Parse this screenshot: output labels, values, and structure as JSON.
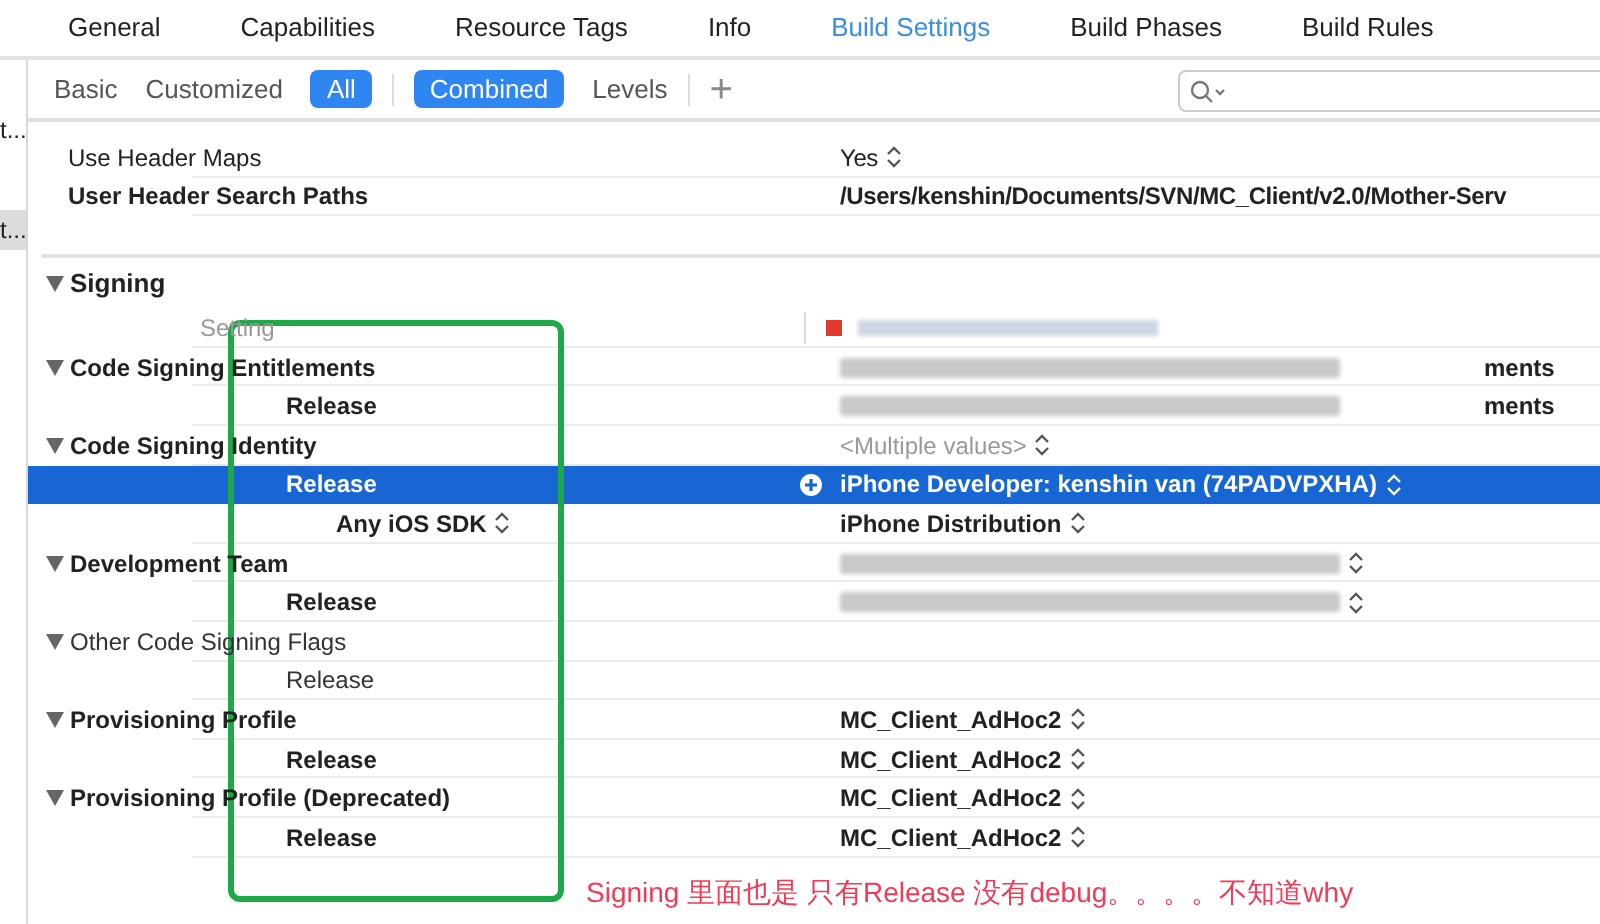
{
  "tabs": [
    {
      "label": "General",
      "selected": false
    },
    {
      "label": "Capabilities",
      "selected": false
    },
    {
      "label": "Resource Tags",
      "selected": false
    },
    {
      "label": "Info",
      "selected": false
    },
    {
      "label": "Build Settings",
      "selected": true
    },
    {
      "label": "Build Phases",
      "selected": false
    },
    {
      "label": "Build Rules",
      "selected": false
    }
  ],
  "sidebar": {
    "items": [
      {
        "label": "t...",
        "selected": false
      },
      {
        "label": "t...",
        "selected": true
      }
    ]
  },
  "filters": {
    "scope": [
      {
        "label": "Basic",
        "selected": false
      },
      {
        "label": "Customized",
        "selected": false
      },
      {
        "label": "All",
        "selected": true
      }
    ],
    "view": [
      {
        "label": "Combined",
        "selected": true
      },
      {
        "label": "Levels",
        "selected": false
      }
    ],
    "add": "+"
  },
  "rows_above": [
    {
      "label": "Use Header Maps",
      "bold": false,
      "value": "Yes",
      "value_bold": false,
      "stepper": true
    },
    {
      "label": "User Header Search Paths",
      "bold": true,
      "value": "/Users/kenshin/Documents/SVN/MC_Client/v2.0/Mother-Serv",
      "value_bold": true,
      "stepper": false
    }
  ],
  "section": {
    "title": "Signing",
    "expanded": true,
    "column_header": "Setting",
    "rows": [
      {
        "kind": "group",
        "label": "Code Signing Entitlements",
        "bold": true,
        "selected": false,
        "value": {
          "kind": "redacted",
          "tail": "ments"
        },
        "stepper": false
      },
      {
        "kind": "child",
        "label": "Release",
        "bold": true,
        "selected": false,
        "value": {
          "kind": "redacted",
          "tail": "ments"
        },
        "stepper": false
      },
      {
        "kind": "group",
        "label": "Code Signing Identity",
        "bold": true,
        "selected": false,
        "value": {
          "kind": "muted",
          "text": "<Multiple values>"
        },
        "stepper": true
      },
      {
        "kind": "child",
        "label": "Release",
        "bold": true,
        "selected": true,
        "value": {
          "kind": "text",
          "text": "iPhone Developer: kenshin van (74PADVPXHA)"
        },
        "stepper": true
      },
      {
        "kind": "subchild",
        "label": "Any iOS SDK",
        "bold": true,
        "selected": false,
        "value": {
          "kind": "text",
          "text": "iPhone Distribution"
        },
        "stepper": true,
        "label_stepper": true
      },
      {
        "kind": "group",
        "label": "Development Team",
        "bold": true,
        "selected": false,
        "value": {
          "kind": "redacted"
        },
        "stepper": true
      },
      {
        "kind": "child",
        "label": "Release",
        "bold": true,
        "selected": false,
        "value": {
          "kind": "redacted"
        },
        "stepper": true
      },
      {
        "kind": "group",
        "label": "Other Code Signing Flags",
        "bold": false,
        "selected": false,
        "stepper": false
      },
      {
        "kind": "child",
        "label": "Release",
        "bold": false,
        "selected": false,
        "stepper": false
      },
      {
        "kind": "group",
        "label": "Provisioning Profile",
        "bold": true,
        "selected": false,
        "value": {
          "kind": "text",
          "text": "MC_Client_AdHoc2"
        },
        "stepper": true
      },
      {
        "kind": "child",
        "label": "Release",
        "bold": true,
        "selected": false,
        "value": {
          "kind": "text",
          "text": "MC_Client_AdHoc2"
        },
        "stepper": true
      },
      {
        "kind": "group",
        "label": "Provisioning Profile (Deprecated)",
        "bold": true,
        "selected": false,
        "value": {
          "kind": "text",
          "text": "MC_Client_AdHoc2"
        },
        "stepper": true
      },
      {
        "kind": "child",
        "label": "Release",
        "bold": true,
        "selected": false,
        "value": {
          "kind": "text",
          "text": "MC_Client_AdHoc2"
        },
        "stepper": true
      }
    ]
  },
  "annotation": {
    "text": "Signing 里面也是 只有Release 没有debug。。。。不知道why"
  }
}
